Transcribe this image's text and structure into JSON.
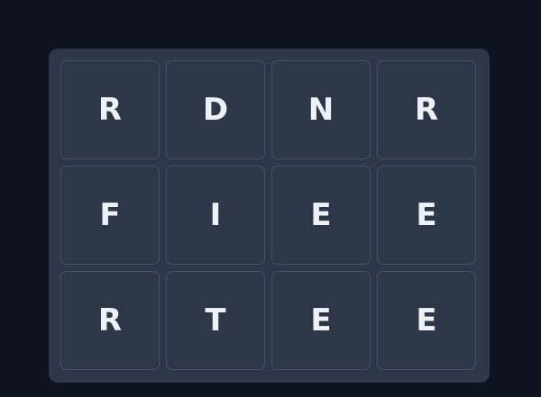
{
  "board": {
    "rows": [
      [
        "R",
        "D",
        "N",
        "R"
      ],
      [
        "F",
        "I",
        "E",
        "E"
      ],
      [
        "R",
        "T",
        "E",
        "E"
      ]
    ]
  }
}
